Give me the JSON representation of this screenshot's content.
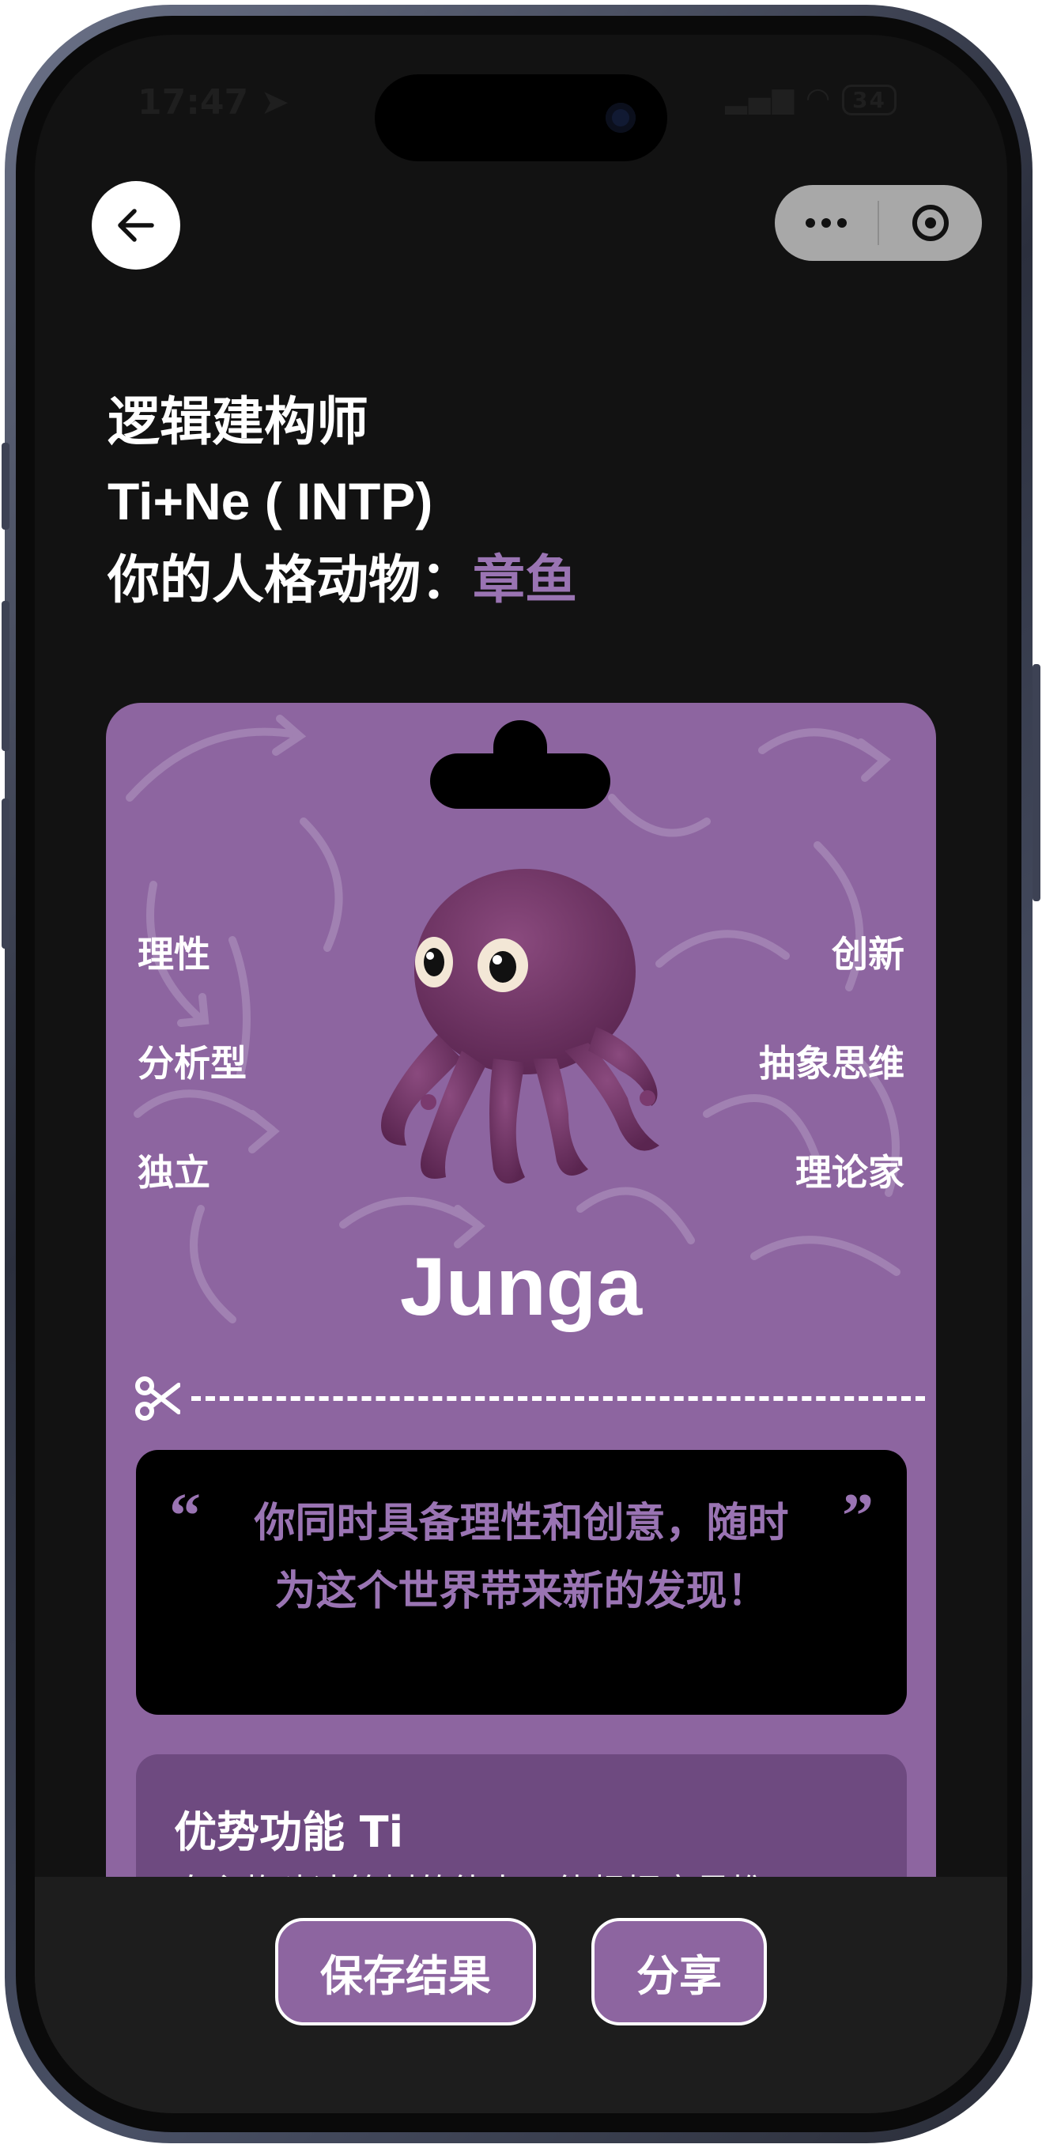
{
  "status_bar": {
    "time": "17:47",
    "battery": "34"
  },
  "header": {
    "title_line1": "逻辑建构师",
    "title_line2": "Ti+Ne ( INTP)",
    "animal_prefix": "你的人格动物：",
    "animal_name": "章鱼"
  },
  "card": {
    "traits_left": [
      "理性",
      "分析型",
      "独立"
    ],
    "traits_right": [
      "创新",
      "抽象思维",
      "理论家"
    ],
    "name": "Junga",
    "quote_open": "“",
    "quote_close": "”",
    "quote": "你同时具备理性和创意，随时为这个世界带来新的发现！",
    "feature_title": "优势功能 Ti",
    "feature_text": "自主构建决策树的能力，能根据变量推"
  },
  "actions": {
    "save_label": "保存结果",
    "share_label": "分享"
  },
  "colors": {
    "accent": "#9a74b3",
    "card": "#8d65a0",
    "background": "#121212"
  }
}
